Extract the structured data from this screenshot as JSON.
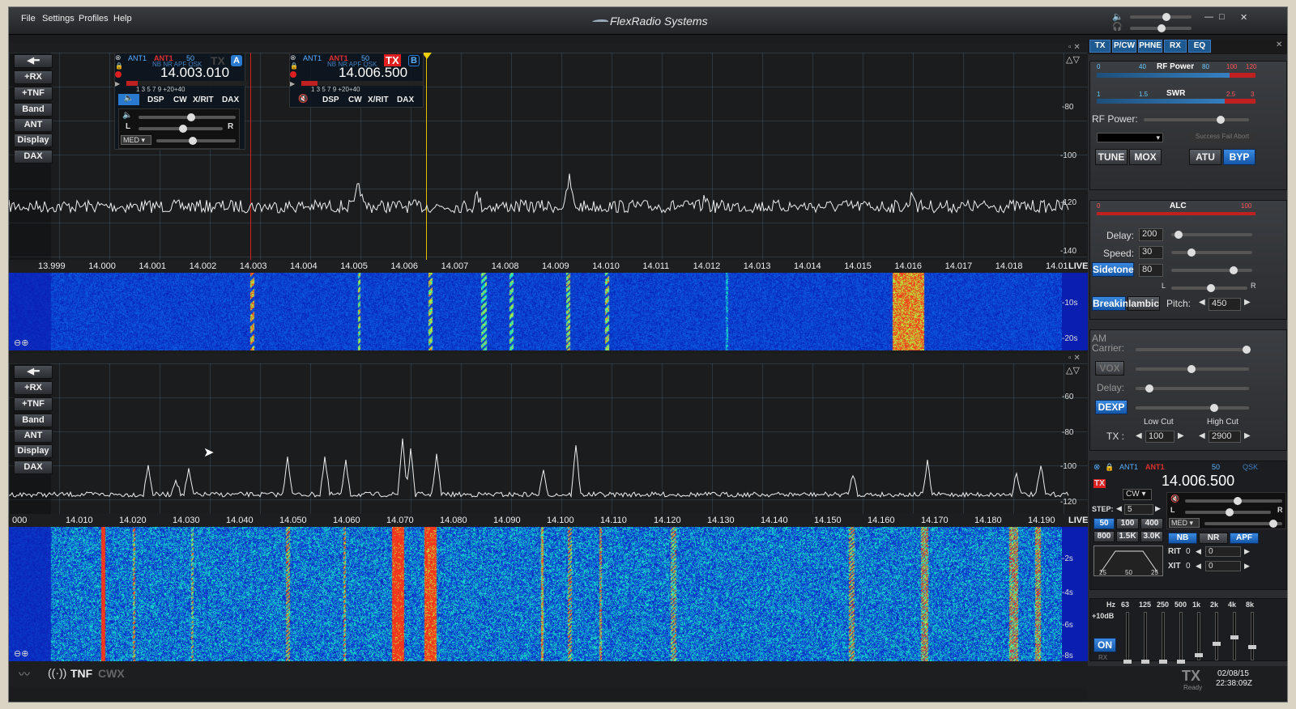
{
  "app": {
    "brand": "FlexRadio Systems",
    "menu": [
      "File",
      "Settings",
      "Profiles",
      "Help"
    ]
  },
  "colors": {
    "accent": "#1e5a90",
    "tx_red": "#e02020",
    "slice_a": "#e02020",
    "slice_b": "#f0c000"
  },
  "pan1": {
    "side": [
      "+RX",
      "+TNF",
      "Band",
      "ANT",
      "Display",
      "DAX"
    ],
    "dbm": [
      "-80",
      "-100",
      "-120",
      "-140"
    ],
    "freqs": [
      "13.999",
      "14.000",
      "14.001",
      "14.002",
      "14.003",
      "14.004",
      "14.005",
      "14.006",
      "14.007",
      "14.008",
      "14.009",
      "14.010",
      "14.011",
      "14.012",
      "14.013",
      "14.014",
      "14.015",
      "14.016",
      "14.017",
      "14.018",
      "14.01"
    ],
    "live": "LIVE",
    "wf_times": [
      "-10s",
      "-20s"
    ],
    "sliceA": {
      "ant_rx": "ANT1",
      "ant_tx": "ANT1",
      "filter": "50",
      "flags": "NB NR APF QSK",
      "tx": "TX",
      "letter": "A",
      "freq": "14.003.010",
      "btns": [
        "DSP",
        "CW",
        "X/RIT",
        "DAX"
      ],
      "scale": "1 3 5 7 9 +20+40",
      "agc": "MED",
      "l": "L",
      "r": "R"
    },
    "sliceB": {
      "ant_rx": "ANT1",
      "ant_tx": "ANT1",
      "filter": "50",
      "flags": "NB NR APF QSK",
      "tx": "TX",
      "letter": "B",
      "freq": "14.006.500",
      "btns": [
        "DSP",
        "CW",
        "X/RIT",
        "DAX"
      ],
      "scale": "1 3 5 7 9 +20+40"
    }
  },
  "pan2": {
    "side": [
      "+RX",
      "+TNF",
      "Band",
      "ANT",
      "Display",
      "DAX"
    ],
    "dbm": [
      "-60",
      "-80",
      "-100",
      "-120"
    ],
    "freqs": [
      "000",
      "14.010",
      "14.020",
      "14.030",
      "14.040",
      "14.050",
      "14.060",
      "14.070",
      "14.080",
      "14.090",
      "14.100",
      "14.110",
      "14.120",
      "14.130",
      "14.140",
      "14.150",
      "14.160",
      "14.170",
      "14.180",
      "14.190"
    ],
    "live": "LIVE",
    "wf_times": [
      "-2s",
      "-4s",
      "-6s",
      "-8s"
    ]
  },
  "status": {
    "tnf": "TNF",
    "cwx": "CWX",
    "tx": "TX",
    "ready": "Ready",
    "date": "02/08/15",
    "time": "22:38:09Z"
  },
  "right": {
    "tabs": [
      "TX",
      "P/CW",
      "PHNE",
      "RX",
      "EQ"
    ],
    "rfpower_meter": "RF Power",
    "swr_meter": "SWR",
    "rf_scale": [
      "0",
      "40",
      "80",
      "100",
      "120"
    ],
    "swr_scale": [
      "1",
      "1.5",
      "2.5",
      "3"
    ],
    "rf_power_label": "RF Power:",
    "atu_status": "Success Fail Abort",
    "tune": "TUNE",
    "mox": "MOX",
    "atu": "ATU",
    "byp": "BYP",
    "alc": "ALC",
    "alc_scale": [
      "0",
      "100"
    ],
    "delay_label": "Delay:",
    "delay": "200",
    "speed_label": "Speed:",
    "speed": "30",
    "sidetone": "Sidetone",
    "sidetone_val": "80",
    "l": "L",
    "r": "R",
    "breakin": "Breakin",
    "iambic": "Iambic",
    "pitch_label": "Pitch:",
    "pitch": "450",
    "am_carrier": "AM Carrier:",
    "vox": "VOX",
    "vox_delay": "Delay:",
    "dexp": "DEXP",
    "low_cut_label": "Low Cut",
    "high_cut_label": "High Cut",
    "tx_label": "TX :",
    "low_cut": "100",
    "high_cut": "2900",
    "slice": {
      "ant_rx": "ANT1",
      "ant_tx": "ANT1",
      "filter": "50",
      "qsk": "QSK",
      "freq": "14.006.500",
      "mode": "CW",
      "step_label": "STEP:",
      "step": "5",
      "filters": [
        "50",
        "100",
        "400",
        "800",
        "1.5K",
        "3.0K"
      ],
      "agc": "MED",
      "nb": "NB",
      "nr": "NR",
      "apf": "APF",
      "rit": "RIT",
      "rit_val": "0",
      "rit_off": "0",
      "xit": "XIT",
      "xit_val": "0",
      "xit_off": "0",
      "fscale": [
        "25",
        "50",
        "25"
      ],
      "l": "L",
      "r": "R"
    },
    "eq": {
      "hz": "Hz",
      "bands": [
        "63",
        "125",
        "250",
        "500",
        "1k",
        "2k",
        "4k",
        "8k"
      ],
      "db": "+10dB",
      "on": "ON",
      "rx": "RX"
    }
  }
}
